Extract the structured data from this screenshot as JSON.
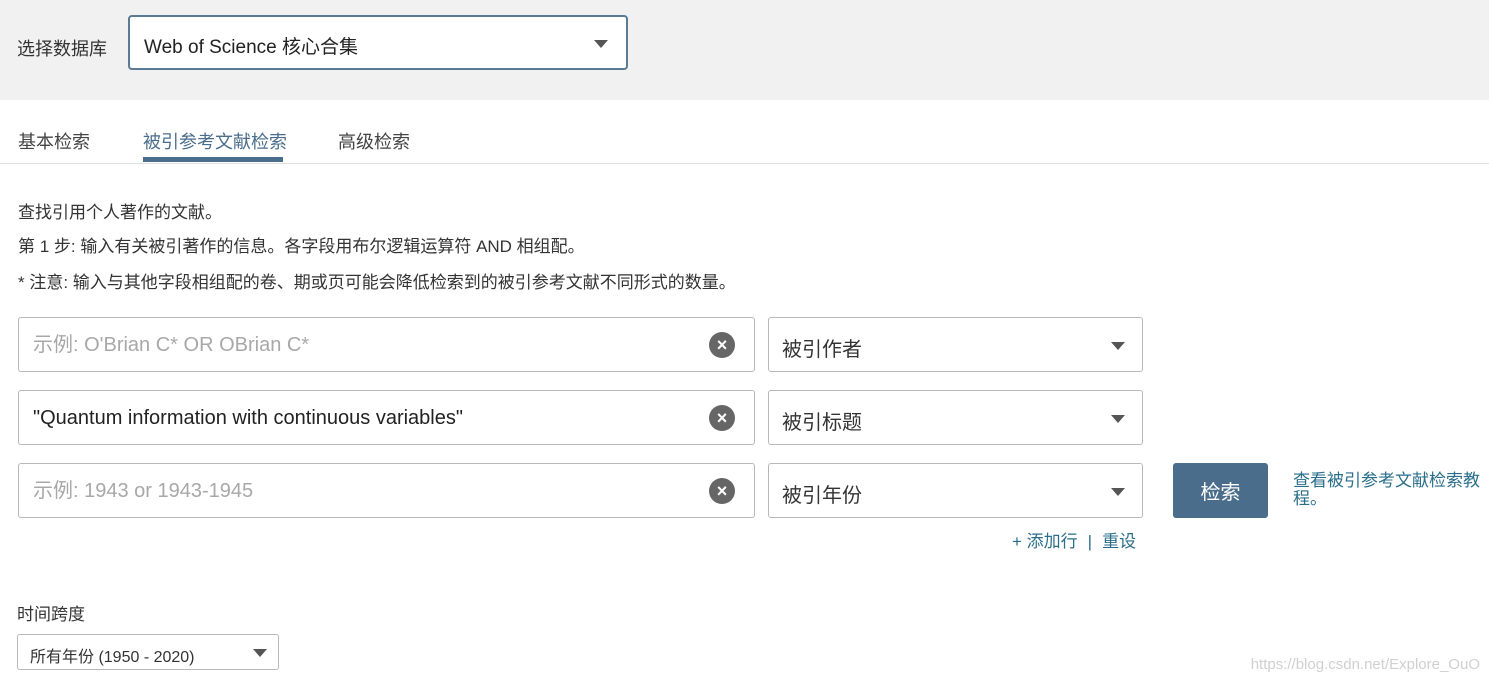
{
  "database": {
    "label": "选择数据库",
    "selected": "Web of Science 核心合集"
  },
  "tabs": [
    {
      "label": "基本检索",
      "active": false
    },
    {
      "label": "被引参考文献检索",
      "active": true
    },
    {
      "label": "高级检索",
      "active": false
    }
  ],
  "description": {
    "line1": "查找引用个人著作的文献。",
    "line2": "第 1 步:  输入有关被引著作的信息。各字段用布尔逻辑运算符 AND 相组配。",
    "line3": "* 注意: 输入与其他字段相组配的卷、期或页可能会降低检索到的被引参考文献不同形式的数量。"
  },
  "rows": [
    {
      "value": "",
      "placeholder": "示例: O'Brian C* OR OBrian C*",
      "field": "被引作者",
      "clear": "×"
    },
    {
      "value": "\"Quantum information with continuous variables\"",
      "placeholder": "",
      "field": "被引标题",
      "clear": "×"
    },
    {
      "value": "",
      "placeholder": "示例: 1943 or 1943-1945",
      "field": "被引年份",
      "clear": "×"
    }
  ],
  "actions": {
    "search": "检索",
    "tutorial": "查看被引参考文献检索教程。",
    "add_row": "+ 添加行",
    "separator": "|",
    "reset": "重设"
  },
  "timespan": {
    "label": "时间跨度",
    "selected": "所有年份 (1950 - 2020)"
  },
  "watermark": "https://blog.csdn.net/Explore_OuO",
  "colors": {
    "accent": "#4a6d8c",
    "link": "#2a6e8a",
    "header_bg": "#f1f1f1"
  }
}
